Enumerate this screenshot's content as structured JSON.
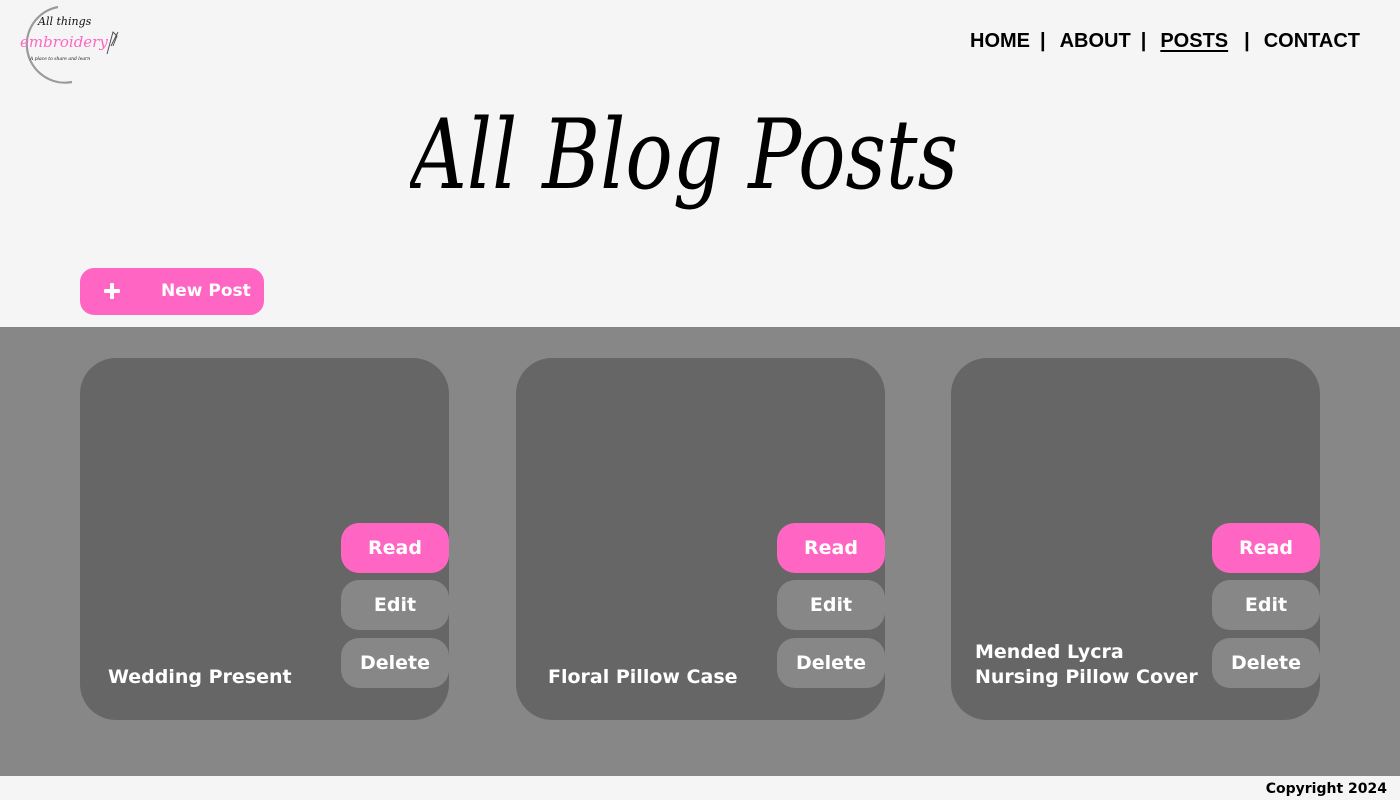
{
  "logo": {
    "line1": "All things",
    "line2": "embroidery",
    "tagline": "A place to share and learn"
  },
  "nav": {
    "items": [
      {
        "label": "HOME",
        "active": false
      },
      {
        "label": "ABOUT",
        "active": false
      },
      {
        "label": "POSTS",
        "active": true
      },
      {
        "label": "CONTACT",
        "active": false
      }
    ],
    "separator": "|"
  },
  "page_title": "All Blog Posts",
  "new_post_label": "New Post",
  "cards": [
    {
      "title": "Wedding Present",
      "read": "Read",
      "edit": "Edit",
      "delete": "Delete"
    },
    {
      "title": "Floral Pillow Case",
      "read": "Read",
      "edit": "Edit",
      "delete": "Delete"
    },
    {
      "title": "Mended Lycra\nNursing Pillow Cover",
      "read": "Read",
      "edit": "Edit",
      "delete": "Delete"
    }
  ],
  "copyright": "Copyright 2024",
  "colors": {
    "accent": "#ff66c4",
    "band": "#878787",
    "card": "#666666",
    "page": "#f5f5f5"
  }
}
